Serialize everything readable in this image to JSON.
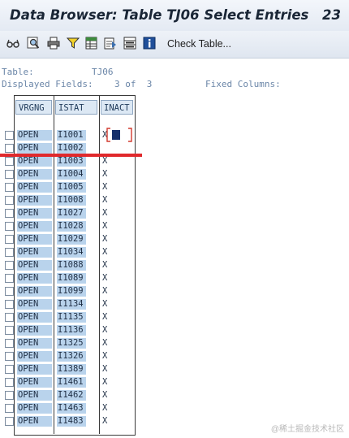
{
  "window": {
    "title": "Data Browser: Table TJ06 Select Entries",
    "count": "23"
  },
  "toolbar": {
    "icons": [
      "glasses-icon",
      "find-icon",
      "print-icon",
      "filter-icon",
      "spreadsheet-icon",
      "export-icon",
      "select-all-icon",
      "info-icon"
    ],
    "check_table_label": "Check Table..."
  },
  "info": {
    "table_label": "Table:",
    "table_value": "TJ06",
    "displayed_label": "Displayed Fields:",
    "displayed_value": "3 of  3",
    "fixed_label": "Fixed Columns:"
  },
  "grid": {
    "headers": [
      "VRGNG",
      "ISTAT",
      "INACT"
    ],
    "rows": [
      {
        "vrgng": "OPEN",
        "istat": "I1001",
        "inact": "X"
      },
      {
        "vrgng": "OPEN",
        "istat": "I1002",
        "inact": ""
      },
      {
        "vrgng": "OPEN",
        "istat": "I1003",
        "inact": "X"
      },
      {
        "vrgng": "OPEN",
        "istat": "I1004",
        "inact": "X"
      },
      {
        "vrgng": "OPEN",
        "istat": "I1005",
        "inact": "X"
      },
      {
        "vrgng": "OPEN",
        "istat": "I1008",
        "inact": "X"
      },
      {
        "vrgng": "OPEN",
        "istat": "I1027",
        "inact": "X"
      },
      {
        "vrgng": "OPEN",
        "istat": "I1028",
        "inact": "X"
      },
      {
        "vrgng": "OPEN",
        "istat": "I1029",
        "inact": "X"
      },
      {
        "vrgng": "OPEN",
        "istat": "I1034",
        "inact": "X"
      },
      {
        "vrgng": "OPEN",
        "istat": "I1088",
        "inact": "X"
      },
      {
        "vrgng": "OPEN",
        "istat": "I1089",
        "inact": "X"
      },
      {
        "vrgng": "OPEN",
        "istat": "I1099",
        "inact": "X"
      },
      {
        "vrgng": "OPEN",
        "istat": "I1134",
        "inact": "X"
      },
      {
        "vrgng": "OPEN",
        "istat": "I1135",
        "inact": "X"
      },
      {
        "vrgng": "OPEN",
        "istat": "I1136",
        "inact": "X"
      },
      {
        "vrgng": "OPEN",
        "istat": "I1325",
        "inact": "X"
      },
      {
        "vrgng": "OPEN",
        "istat": "I1326",
        "inact": "X"
      },
      {
        "vrgng": "OPEN",
        "istat": "I1389",
        "inact": "X"
      },
      {
        "vrgng": "OPEN",
        "istat": "I1461",
        "inact": "X"
      },
      {
        "vrgng": "OPEN",
        "istat": "I1462",
        "inact": "X"
      },
      {
        "vrgng": "OPEN",
        "istat": "I1463",
        "inact": "X"
      },
      {
        "vrgng": "OPEN",
        "istat": "I1483",
        "inact": "X"
      }
    ]
  },
  "colors": {
    "highlight": "#b9d3ec",
    "annotation_red": "#e0292c"
  },
  "watermark": "@稀土掘金技术社区"
}
